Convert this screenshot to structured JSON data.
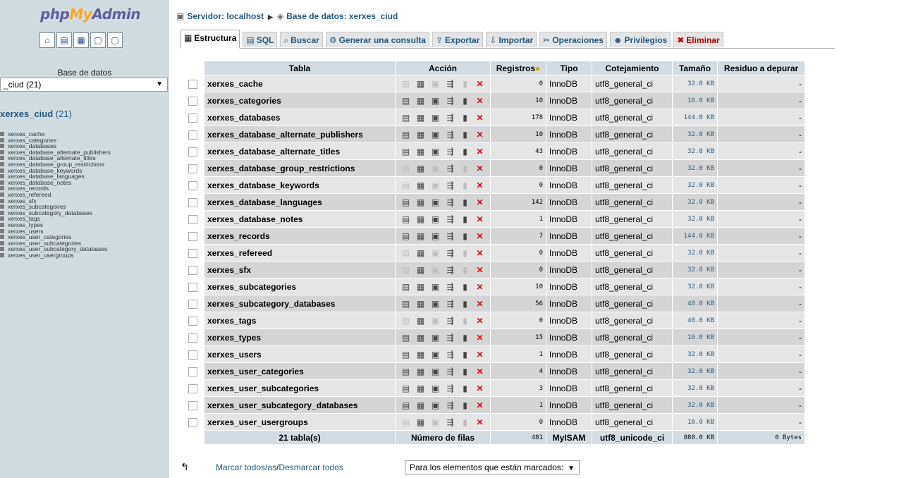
{
  "sidebar": {
    "logo": {
      "php": "php",
      "my": "My",
      "admin": "Admin"
    },
    "icons": [
      "home-icon",
      "query-icon",
      "sql-icon",
      "docs-icon",
      "docs-icon"
    ],
    "db_label": "Base de datos",
    "db_select": "_ciud (21)",
    "current_db": "xerxes_ciud",
    "current_db_count": "(21)",
    "tables": [
      "xerxes_cache",
      "xerxes_categories",
      "xerxes_databases",
      "xerxes_database_alternate_publishers",
      "xerxes_database_alternate_titles",
      "xerxes_database_group_restrictions",
      "xerxes_database_keywords",
      "xerxes_database_languages",
      "xerxes_database_notes",
      "xerxes_records",
      "xerxes_refereed",
      "xerxes_sfx",
      "xerxes_subcategories",
      "xerxes_subcategory_databases",
      "xerxes_tags",
      "xerxes_types",
      "xerxes_users",
      "xerxes_user_categories",
      "xerxes_user_subcategories",
      "xerxes_user_subcategory_databases",
      "xerxes_user_usergroups"
    ]
  },
  "breadcrumb": {
    "server": "Servidor: localhost",
    "database": "Base de datos: xerxes_ciud"
  },
  "tabs": [
    {
      "label": "Estructura",
      "icon": "structure-icon"
    },
    {
      "label": "SQL",
      "icon": "sql-icon"
    },
    {
      "label": "Buscar",
      "icon": "search-icon"
    },
    {
      "label": "Generar una consulta",
      "icon": "query-icon"
    },
    {
      "label": "Exportar",
      "icon": "export-icon"
    },
    {
      "label": "Importar",
      "icon": "import-icon"
    },
    {
      "label": "Operaciones",
      "icon": "operations-icon"
    },
    {
      "label": "Privilegios",
      "icon": "privileges-icon"
    },
    {
      "label": "Eliminar",
      "icon": "drop-icon"
    }
  ],
  "table": {
    "headers": {
      "table": "Tabla",
      "action": "Acción",
      "records": "Registros",
      "type": "Tipo",
      "collation": "Cotejamiento",
      "size": "Tamaño",
      "overhead": "Residuo a depurar"
    },
    "rows": [
      {
        "name": "xerxes_cache",
        "records": "0",
        "type": "InnoDB",
        "collation": "utf8_general_ci",
        "size": "32.0 KB",
        "overhead": "-",
        "empty": true
      },
      {
        "name": "xerxes_categories",
        "records": "10",
        "type": "InnoDB",
        "collation": "utf8_general_ci",
        "size": "16.0 KB",
        "overhead": "-",
        "empty": false
      },
      {
        "name": "xerxes_databases",
        "records": "178",
        "type": "InnoDB",
        "collation": "utf8_general_ci",
        "size": "144.0 KB",
        "overhead": "-",
        "empty": false
      },
      {
        "name": "xerxes_database_alternate_publishers",
        "records": "10",
        "type": "InnoDB",
        "collation": "utf8_general_ci",
        "size": "32.0 KB",
        "overhead": "-",
        "empty": false
      },
      {
        "name": "xerxes_database_alternate_titles",
        "records": "43",
        "type": "InnoDB",
        "collation": "utf8_general_ci",
        "size": "32.0 KB",
        "overhead": "-",
        "empty": false
      },
      {
        "name": "xerxes_database_group_restrictions",
        "records": "0",
        "type": "InnoDB",
        "collation": "utf8_general_ci",
        "size": "32.0 KB",
        "overhead": "-",
        "empty": true
      },
      {
        "name": "xerxes_database_keywords",
        "records": "0",
        "type": "InnoDB",
        "collation": "utf8_general_ci",
        "size": "32.0 KB",
        "overhead": "-",
        "empty": true
      },
      {
        "name": "xerxes_database_languages",
        "records": "142",
        "type": "InnoDB",
        "collation": "utf8_general_ci",
        "size": "32.0 KB",
        "overhead": "-",
        "empty": false
      },
      {
        "name": "xerxes_database_notes",
        "records": "1",
        "type": "InnoDB",
        "collation": "utf8_general_ci",
        "size": "32.0 KB",
        "overhead": "-",
        "empty": false
      },
      {
        "name": "xerxes_records",
        "records": "7",
        "type": "InnoDB",
        "collation": "utf8_general_ci",
        "size": "144.0 KB",
        "overhead": "-",
        "empty": false
      },
      {
        "name": "xerxes_refereed",
        "records": "0",
        "type": "InnoDB",
        "collation": "utf8_general_ci",
        "size": "32.0 KB",
        "overhead": "-",
        "empty": true
      },
      {
        "name": "xerxes_sfx",
        "records": "0",
        "type": "InnoDB",
        "collation": "utf8_general_ci",
        "size": "32.0 KB",
        "overhead": "-",
        "empty": true
      },
      {
        "name": "xerxes_subcategories",
        "records": "10",
        "type": "InnoDB",
        "collation": "utf8_general_ci",
        "size": "32.0 KB",
        "overhead": "-",
        "empty": false
      },
      {
        "name": "xerxes_subcategory_databases",
        "records": "56",
        "type": "InnoDB",
        "collation": "utf8_general_ci",
        "size": "48.0 KB",
        "overhead": "-",
        "empty": false
      },
      {
        "name": "xerxes_tags",
        "records": "0",
        "type": "InnoDB",
        "collation": "utf8_general_ci",
        "size": "48.0 KB",
        "overhead": "-",
        "empty": true
      },
      {
        "name": "xerxes_types",
        "records": "15",
        "type": "InnoDB",
        "collation": "utf8_general_ci",
        "size": "16.0 KB",
        "overhead": "-",
        "empty": false
      },
      {
        "name": "xerxes_users",
        "records": "1",
        "type": "InnoDB",
        "collation": "utf8_general_ci",
        "size": "32.0 KB",
        "overhead": "-",
        "empty": false
      },
      {
        "name": "xerxes_user_categories",
        "records": "4",
        "type": "InnoDB",
        "collation": "utf8_general_ci",
        "size": "32.0 KB",
        "overhead": "-",
        "empty": false
      },
      {
        "name": "xerxes_user_subcategories",
        "records": "3",
        "type": "InnoDB",
        "collation": "utf8_general_ci",
        "size": "32.0 KB",
        "overhead": "-",
        "empty": false
      },
      {
        "name": "xerxes_user_subcategory_databases",
        "records": "1",
        "type": "InnoDB",
        "collation": "utf8_general_ci",
        "size": "32.0 KB",
        "overhead": "-",
        "empty": false
      },
      {
        "name": "xerxes_user_usergroups",
        "records": "0",
        "type": "InnoDB",
        "collation": "utf8_general_ci",
        "size": "16.0 KB",
        "overhead": "-",
        "empty": true
      }
    ],
    "footer": {
      "count": "21 tabla(s)",
      "rows_label": "Número de filas",
      "total_records": "481",
      "type": "MyISAM",
      "collation": "utf8_unicode_ci",
      "size": "880.0 KB",
      "overhead": "0 Bytes"
    }
  },
  "bottom": {
    "check_all": "Marcar todos/as",
    "separator": " / ",
    "uncheck_all": "Desmarcar todos",
    "bulk_select": "Para los elementos que están marcados:"
  }
}
